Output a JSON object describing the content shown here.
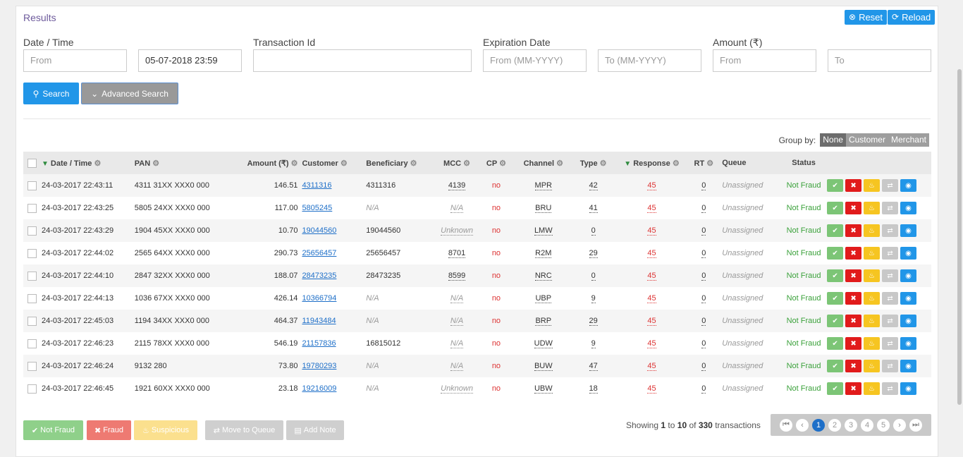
{
  "panel": {
    "title": "Results",
    "reset_label": "Reset",
    "reload_label": "Reload"
  },
  "filters": {
    "date_label": "Date / Time",
    "date_from_placeholder": "From",
    "date_to_value": "05-07-2018 23:59",
    "txn_label": "Transaction Id",
    "txn_value": "",
    "exp_label": "Expiration Date",
    "exp_from_placeholder": "From (MM-YYYY)",
    "exp_to_placeholder": "To (MM-YYYY)",
    "amount_label": "Amount (₹)",
    "amount_from_placeholder": "From",
    "amount_to_placeholder": "To"
  },
  "actions": {
    "search_label": "Search",
    "advanced_label": "Advanced Search"
  },
  "groupby": {
    "label": "Group by:",
    "options": [
      "None",
      "Customer",
      "Merchant"
    ],
    "selected": "None"
  },
  "columns": {
    "date": "Date / Time",
    "pan": "PAN",
    "amount": "Amount (₹)",
    "customer": "Customer",
    "beneficiary": "Beneficiary",
    "mcc": "MCC",
    "cp": "CP",
    "channel": "Channel",
    "type": "Type",
    "response": "Response",
    "rt": "RT",
    "queue": "Queue",
    "status": "Status"
  },
  "rows": [
    {
      "date": "24-03-2017 22:43:11",
      "pan": "4311 31XX XXX0 000",
      "amount": "146.51",
      "customer": "4311316",
      "beneficiary": "4311316",
      "mcc": "4139",
      "cp": "no",
      "channel": "MPR",
      "type": "42",
      "response": "45",
      "rt": "0",
      "queue": "Unassigned",
      "status": "Not Fraud"
    },
    {
      "date": "24-03-2017 22:43:25",
      "pan": "5805 24XX XXX0 000",
      "amount": "117.00",
      "customer": "5805245",
      "beneficiary": "N/A",
      "mcc": "N/A",
      "cp": "no",
      "channel": "BRU",
      "type": "41",
      "response": "45",
      "rt": "0",
      "queue": "Unassigned",
      "status": "Not Fraud"
    },
    {
      "date": "24-03-2017 22:43:29",
      "pan": "1904 45XX XXX0 000",
      "amount": "10.70",
      "customer": "19044560",
      "beneficiary": "19044560",
      "mcc": "Unknown",
      "cp": "no",
      "channel": "LMW",
      "type": "0",
      "response": "45",
      "rt": "0",
      "queue": "Unassigned",
      "status": "Not Fraud"
    },
    {
      "date": "24-03-2017 22:44:02",
      "pan": "2565 64XX XXX0 000",
      "amount": "290.73",
      "customer": "25656457",
      "beneficiary": "25656457",
      "mcc": "8701",
      "cp": "no",
      "channel": "R2M",
      "type": "29",
      "response": "45",
      "rt": "0",
      "queue": "Unassigned",
      "status": "Not Fraud"
    },
    {
      "date": "24-03-2017 22:44:10",
      "pan": "2847 32XX XXX0 000",
      "amount": "188.07",
      "customer": "28473235",
      "beneficiary": "28473235",
      "mcc": "8599",
      "cp": "no",
      "channel": "NRC",
      "type": "0",
      "response": "45",
      "rt": "0",
      "queue": "Unassigned",
      "status": "Not Fraud"
    },
    {
      "date": "24-03-2017 22:44:13",
      "pan": "1036 67XX XXX0 000",
      "amount": "426.14",
      "customer": "10366794",
      "beneficiary": "N/A",
      "mcc": "N/A",
      "cp": "no",
      "channel": "UBP",
      "type": "9",
      "response": "45",
      "rt": "0",
      "queue": "Unassigned",
      "status": "Not Fraud"
    },
    {
      "date": "24-03-2017 22:45:03",
      "pan": "1194 34XX XXX0 000",
      "amount": "464.37",
      "customer": "11943484",
      "beneficiary": "N/A",
      "mcc": "N/A",
      "cp": "no",
      "channel": "BRP",
      "type": "29",
      "response": "45",
      "rt": "0",
      "queue": "Unassigned",
      "status": "Not Fraud"
    },
    {
      "date": "24-03-2017 22:46:23",
      "pan": "2115 78XX XXX0 000",
      "amount": "546.19",
      "customer": "21157836",
      "beneficiary": "16815012",
      "mcc": "N/A",
      "cp": "no",
      "channel": "UDW",
      "type": "9",
      "response": "45",
      "rt": "0",
      "queue": "Unassigned",
      "status": "Not Fraud"
    },
    {
      "date": "24-03-2017 22:46:24",
      "pan": "9132 280",
      "amount": "73.80",
      "customer": "19780293",
      "beneficiary": "N/A",
      "mcc": "N/A",
      "cp": "no",
      "channel": "BUW",
      "type": "47",
      "response": "45",
      "rt": "0",
      "queue": "Unassigned",
      "status": "Not Fraud"
    },
    {
      "date": "24-03-2017 22:46:45",
      "pan": "1921 60XX XXX0 000",
      "amount": "23.18",
      "customer": "19216009",
      "beneficiary": "N/A",
      "mcc": "Unknown",
      "cp": "no",
      "channel": "UBW",
      "type": "18",
      "response": "45",
      "rt": "0",
      "queue": "Unassigned",
      "status": "Not Fraud"
    }
  ],
  "bulk": {
    "not_fraud": "Not Fraud",
    "fraud": "Fraud",
    "suspicious": "Suspicious",
    "move_queue": "Move to Queue",
    "add_note": "Add Note"
  },
  "paging": {
    "showing_prefix": "Showing",
    "from": "1",
    "to_word": "to",
    "to": "10",
    "of_word": "of",
    "total": "330",
    "suffix": "transactions",
    "pages": [
      "1",
      "2",
      "3",
      "4",
      "5"
    ],
    "current": "1"
  },
  "colors": {
    "primary": "#2196e8",
    "success": "#7cc576",
    "danger": "#e11b1b",
    "warning": "#f6c521",
    "title": "#6e5b9c"
  }
}
